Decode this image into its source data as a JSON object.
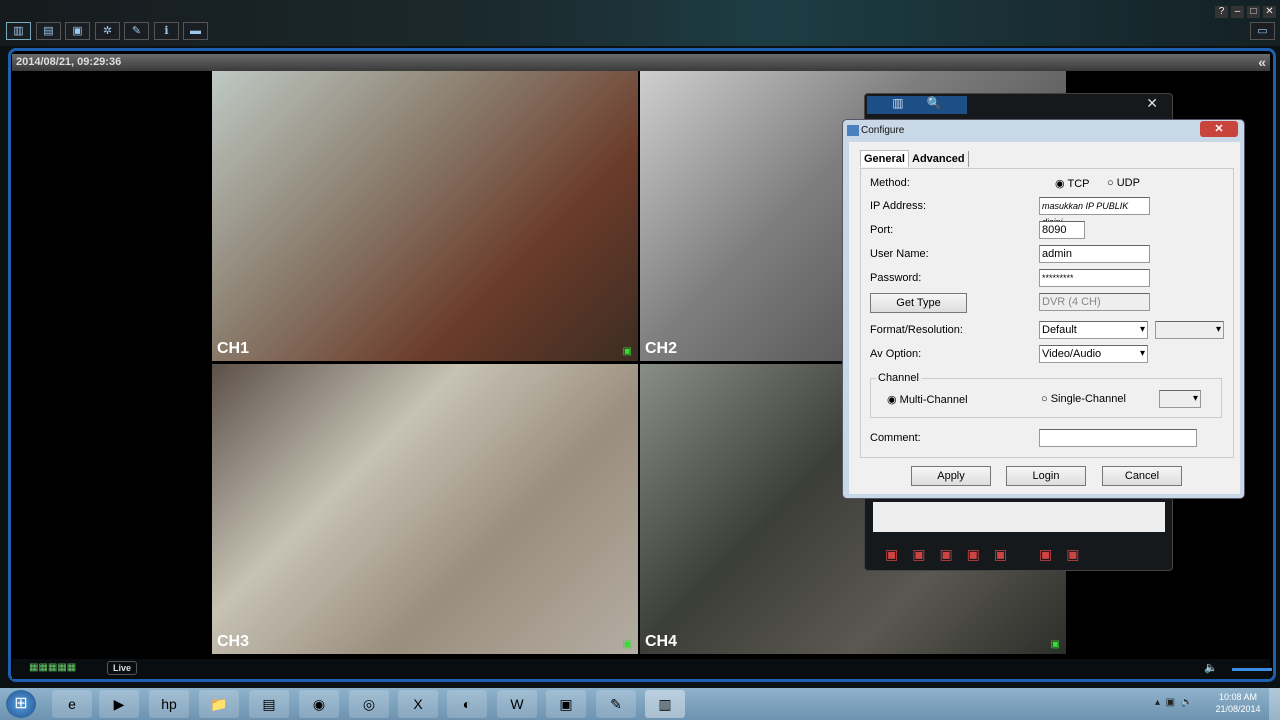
{
  "app": {
    "toolbar_icons": [
      "live-view-icon",
      "playback-icon",
      "backup-icon",
      "config-icon",
      "remote-icon",
      "info-icon",
      "network-icon"
    ],
    "window_buttons": [
      "?",
      "–",
      "□",
      "✕"
    ],
    "datetime": "2014/08/21, 09:29:36",
    "collapse": "«",
    "live_label": "Live"
  },
  "channels": [
    {
      "label": "CH1",
      "color": "#6b5648"
    },
    {
      "label": "CH2",
      "color": "#7a7a7a"
    },
    {
      "label": "CH3",
      "color": "#8a8378"
    },
    {
      "label": "CH4",
      "color": "#4f5248"
    }
  ],
  "dialog": {
    "title": "Configure",
    "close": "✕",
    "tabs": [
      "General",
      "Advanced"
    ],
    "method_label": "Method:",
    "tcp": "TCP",
    "udp": "UDP",
    "ip_label": "IP Address:",
    "ip_value": "masukkan IP PUBLIK disini",
    "port_label": "Port:",
    "port_value": "8090",
    "user_label": "User Name:",
    "user_value": "admin",
    "pass_label": "Password:",
    "pass_value": "*********",
    "get_type": "Get Type",
    "type_value": "DVR (4 CH)",
    "format_label": "Format/Resolution:",
    "format_value": "Default",
    "av_label": "Av Option:",
    "av_value": "Video/Audio",
    "channel_group": "Channel",
    "multi": "Multi-Channel",
    "single": "Single-Channel",
    "comment_label": "Comment:",
    "apply": "Apply",
    "login": "Login",
    "cancel": "Cancel"
  },
  "taskbar": {
    "time": "10:08 AM",
    "date": "21/08/2014",
    "apps": [
      "ie",
      "media-player",
      "hp",
      "explorer",
      "winrar",
      "chrome",
      "firefox",
      "excel",
      "app",
      "word",
      "photos",
      "paint",
      "dvr-client"
    ]
  }
}
